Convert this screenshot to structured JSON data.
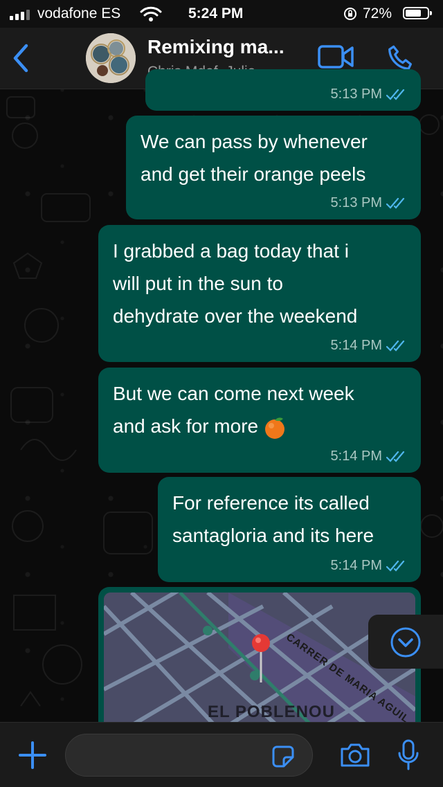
{
  "status_bar": {
    "carrier": "vodafone ES",
    "time": "5:24 PM",
    "battery_percent": "72%",
    "battery_level": 0.72
  },
  "header": {
    "title": "Remixing ma...",
    "subtitle": "Chris Mdef, Julia..."
  },
  "messages": [
    {
      "text": "",
      "time": "5:13 PM",
      "read": true
    },
    {
      "text": "We can pass by whenever\nand get their orange peels",
      "time": "5:13 PM",
      "read": true
    },
    {
      "text": "I grabbed a bag today that i\nwill put in the sun to\ndehydrate over the weekend",
      "time": "5:14 PM",
      "read": true
    },
    {
      "text": "But we can come next week\nand ask for more",
      "time": "5:14 PM",
      "read": true,
      "emoji": "orange"
    },
    {
      "text": "For reference its called\nsantagloria and its here",
      "time": "5:14 PM",
      "read": true
    }
  ],
  "location": {
    "street_label": "CARRER DE MARIA AGUIL",
    "district_label": "EL POBLENOU"
  },
  "composer": {
    "placeholder": ""
  },
  "colors": {
    "accent": "#3b8ff5",
    "bubble": "#005046",
    "read_ticks": "#4fb6ec",
    "pin": "#e53935"
  },
  "icons": [
    "back-icon",
    "video-call-icon",
    "phone-icon",
    "scroll-down-icon",
    "plus-icon",
    "sticker-icon",
    "camera-icon",
    "microphone-icon",
    "location-pin-icon",
    "double-check-icon",
    "orange-emoji-icon"
  ]
}
